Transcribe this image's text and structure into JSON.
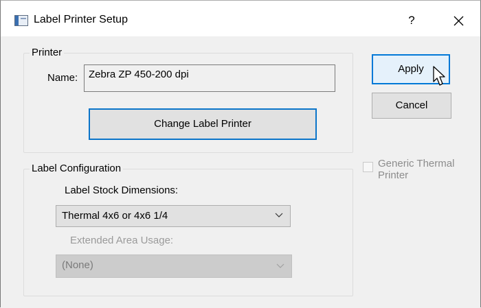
{
  "window": {
    "title": "Label Printer Setup",
    "help_label": "?",
    "icon": "app-window-icon",
    "close_icon": "close-icon"
  },
  "printer_group": {
    "label": "Printer",
    "name_label": "Name:",
    "name_value": "Zebra  ZP 450-200 dpi",
    "change_button": "Change Label Printer"
  },
  "buttons": {
    "apply": "Apply",
    "cancel": "Cancel"
  },
  "generic_thermal": {
    "label": "Generic Thermal Printer",
    "checked": false,
    "enabled": false
  },
  "label_config": {
    "label": "Label Configuration",
    "stock_label": "Label Stock Dimensions:",
    "stock_value": "Thermal 4x6 or 4x6 1/4",
    "extended_label": "Extended Area Usage:",
    "extended_value": "(None)",
    "extended_enabled": false
  },
  "colors": {
    "focus_border": "#0078d7",
    "disabled_text": "#9a9a9a"
  }
}
